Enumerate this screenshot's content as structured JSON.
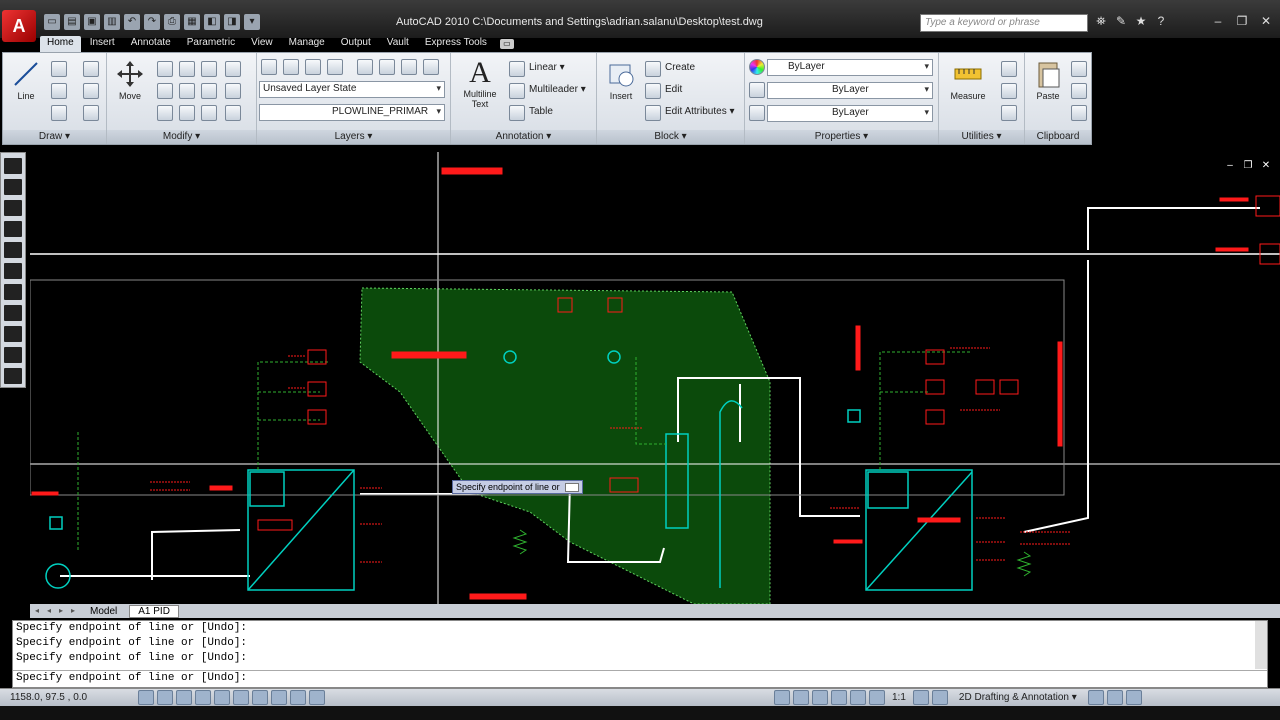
{
  "title_bar": {
    "app_logo": "A",
    "title": "AutoCAD 2010    C:\\Documents and Settings\\adrian.salanu\\Desktop\\test.dwg",
    "search_placeholder": "Type a keyword or phrase"
  },
  "ribbon": {
    "tabs": [
      "Home",
      "Insert",
      "Annotate",
      "Parametric",
      "View",
      "Manage",
      "Output",
      "Vault",
      "Express Tools"
    ],
    "active_tab": "Home",
    "panels": {
      "draw": {
        "title": "Draw",
        "line_label": "Line"
      },
      "modify": {
        "title": "Modify",
        "move_label": "Move"
      },
      "layers": {
        "title": "Layers",
        "layer_state": "Unsaved Layer State",
        "current_layer": "PLOWLINE_PRIMAR"
      },
      "annotation": {
        "title": "Annotation",
        "mtext_label": "Multiline\nText",
        "linear": "Linear",
        "multileader": "Multileader",
        "table": "Table"
      },
      "block": {
        "title": "Block",
        "insert_label": "Insert",
        "create": "Create",
        "edit": "Edit",
        "edit_attributes": "Edit Attributes"
      },
      "properties": {
        "title": "Properties",
        "color": "ByLayer",
        "linetype": "ByLayer",
        "lineweight": "ByLayer"
      },
      "utilities": {
        "title": "Utilities",
        "measure_label": "Measure"
      },
      "clipboard": {
        "title": "Clipboard",
        "paste_label": "Paste"
      }
    }
  },
  "drawing": {
    "dynamic_prompt": "Specify endpoint of line or"
  },
  "layout_tabs": [
    "Model",
    "A1 PID"
  ],
  "active_layout": "A1 PID",
  "command_history": [
    "Specify endpoint of line or [Undo]:",
    "Specify endpoint of line or [Undo]:",
    "Specify endpoint of line or [Undo]:"
  ],
  "command_prompt": "Specify endpoint of line or [Undo]:",
  "status": {
    "coords": "1158.0, 97.5 , 0.0",
    "annotation_scale": "1:1",
    "workspace": "2D Drafting & Annotation"
  },
  "colors": {
    "cad_red": "#ff1a1a",
    "cad_green": "#2fb02f",
    "cad_cyan": "#00d0c0",
    "hatch_green": "#0b4a0b",
    "cad_white": "#ffffff"
  }
}
